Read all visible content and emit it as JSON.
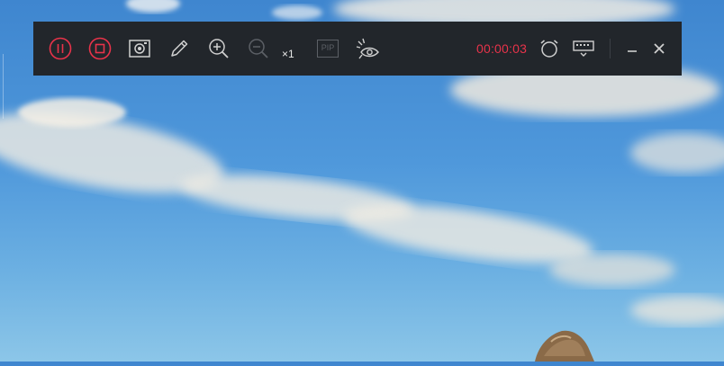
{
  "toolbar": {
    "zoom_level": "×1",
    "pip_label": "PIP",
    "timer": "00:00:03"
  },
  "colors": {
    "toolbar_bg": "#22262b",
    "accent_red": "#e8334a",
    "icon_gray": "#d0d0d0",
    "icon_disabled": "#5c6066"
  },
  "icons": {
    "pause": "pause-icon",
    "stop": "stop-icon",
    "screenshot": "camera-icon",
    "annotate": "pencil-icon",
    "zoom_in": "zoom-in-icon",
    "zoom_out": "zoom-out-icon",
    "pip": "pip-icon",
    "spotlight": "eye-icon",
    "schedule": "alarm-clock-icon",
    "settings": "keyboard-dropdown-icon",
    "minimize": "minimize-icon",
    "close": "close-icon"
  }
}
